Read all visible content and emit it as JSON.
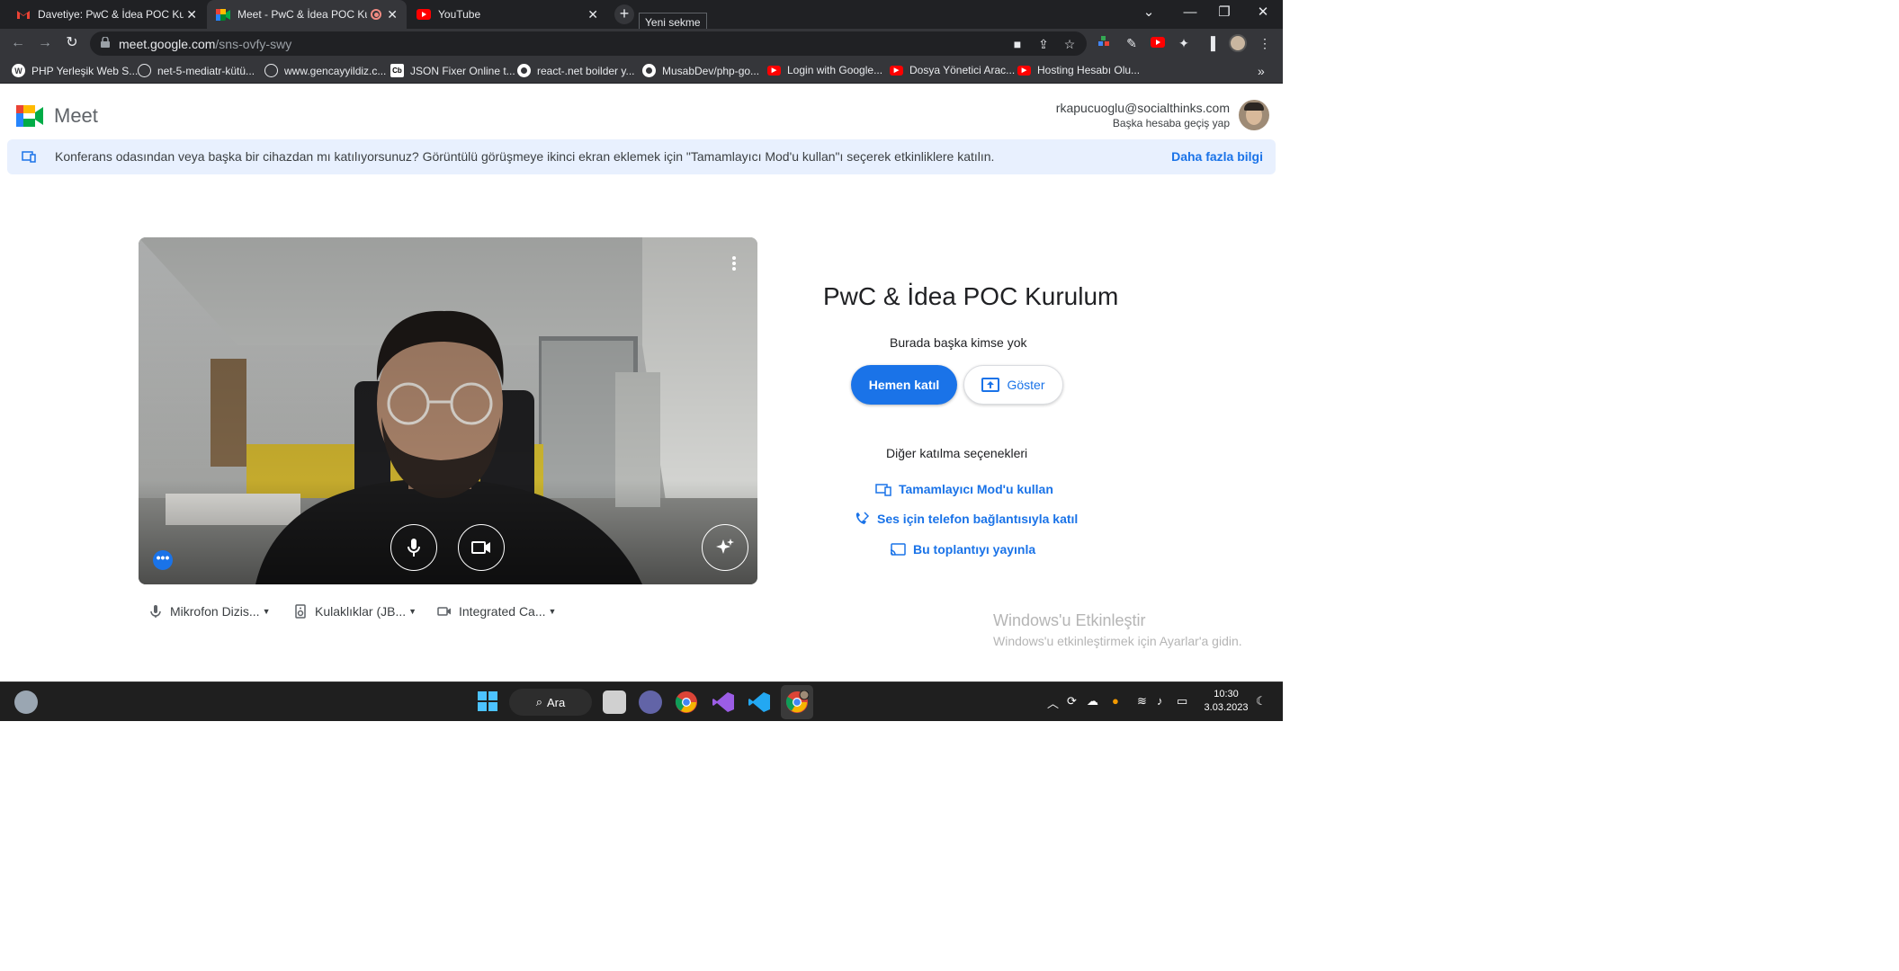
{
  "browser": {
    "tabs": [
      {
        "title": "Davetiye: PwC & İdea POC Kurulum",
        "favicon": "gmail-icon",
        "active": false
      },
      {
        "title": "Meet - PwC & İdea POC Kurulum",
        "favicon": "meet-icon",
        "active": true
      },
      {
        "title": "YouTube",
        "favicon": "youtube-icon",
        "active": false
      }
    ],
    "new_tab_tooltip": "Yeni sekme",
    "url_host": "meet.google.com",
    "url_path": "/sns-ovfy-swy"
  },
  "bookmarks": [
    {
      "label": "PHP Yerleşik Web S...",
      "icon": "wordpress-icon",
      "color": "#ffffff"
    },
    {
      "label": "net-5-mediatr-kütü...",
      "icon": "globe-icon",
      "color": "#e8eaed"
    },
    {
      "label": "www.gencayyildiz.c...",
      "icon": "globe-icon",
      "color": "#e8eaed"
    },
    {
      "label": "JSON Fixer Online t...",
      "icon": "cb-icon",
      "color": "#ffffff"
    },
    {
      "label": "react-.net boilder y...",
      "icon": "github-icon",
      "color": "#ffffff"
    },
    {
      "label": "MusabDev/php-go...",
      "icon": "github-icon",
      "color": "#ffffff"
    },
    {
      "label": "Login with Google...",
      "icon": "youtube-icon",
      "color": "#ff0000"
    },
    {
      "label": "Dosya Yönetici Arac...",
      "icon": "youtube-icon",
      "color": "#ff0000"
    },
    {
      "label": "Hosting Hesabı Olu...",
      "icon": "youtube-icon",
      "color": "#ff0000"
    }
  ],
  "meet": {
    "product_name": "Meet",
    "account_email": "rkapucuoglu@socialthinks.com",
    "switch_account": "Başka hesaba geçiş yap",
    "banner_text": "Konferans odasından veya başka bir cihazdan mı katılıyorsunuz? Görüntülü görüşmeye ikinci ekran eklemek için \"Tamamlayıcı Mod'u kullan\"ı seçerek etkinliklere katılın.",
    "banner_link": "Daha fazla bilgi",
    "meeting_title": "PwC & İdea POC Kurulum",
    "nobody_here": "Burada başka kimse yok",
    "join_now": "Hemen katıl",
    "present": "Göster",
    "other_options_title": "Diğer katılma seçenekleri",
    "options": {
      "companion": "Tamamlayıcı Mod'u kullan",
      "phone_audio": "Ses için telefon bağlantısıyla katıl",
      "cast": "Bu toplantıyı yayınla"
    },
    "devices": {
      "mic": "Mikrofon Dizis...",
      "speaker": "Kulaklıklar (JB...",
      "camera": "Integrated Ca..."
    },
    "more_dots": "•••",
    "accent": "#1a73e8"
  },
  "windows": {
    "watermark_title": "Windows'u Etkinleştir",
    "watermark_sub": "Windows'u etkinleştirmek için Ayarlar'a gidin.",
    "search_label": "Ara",
    "time": "10:30",
    "date": "3.03.2023"
  }
}
